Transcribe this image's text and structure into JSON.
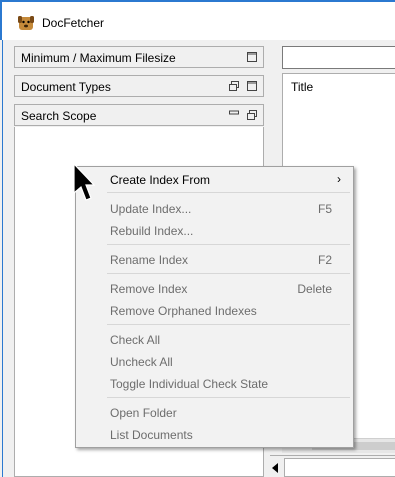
{
  "window": {
    "title": "DocFetcher"
  },
  "left_panel": {
    "filesize_header": "Minimum / Maximum Filesize",
    "doc_types_header": "Document Types",
    "search_scope_header": "Search Scope"
  },
  "results": {
    "column_title": "Title"
  },
  "context_menu": {
    "create_index_from": "Create Index From",
    "update_index": "Update Index...",
    "update_index_shortcut": "F5",
    "rebuild_index": "Rebuild Index...",
    "rename_index": "Rename Index",
    "rename_index_shortcut": "F2",
    "remove_index": "Remove Index",
    "remove_index_shortcut": "Delete",
    "remove_orphaned": "Remove Orphaned Indexes",
    "check_all": "Check All",
    "uncheck_all": "Uncheck All",
    "toggle_check": "Toggle Individual Check State",
    "open_folder": "Open Folder",
    "list_documents": "List Documents",
    "submenu_arrow": "›"
  },
  "icons": {
    "app": "docfetcher-dog-icon",
    "maximize": "maximize-icon",
    "restore": "restore-icon",
    "minimize": "minimize-icon"
  },
  "colors": {
    "window_border": "#2b79d0",
    "disabled_text": "#6d6d6d"
  }
}
